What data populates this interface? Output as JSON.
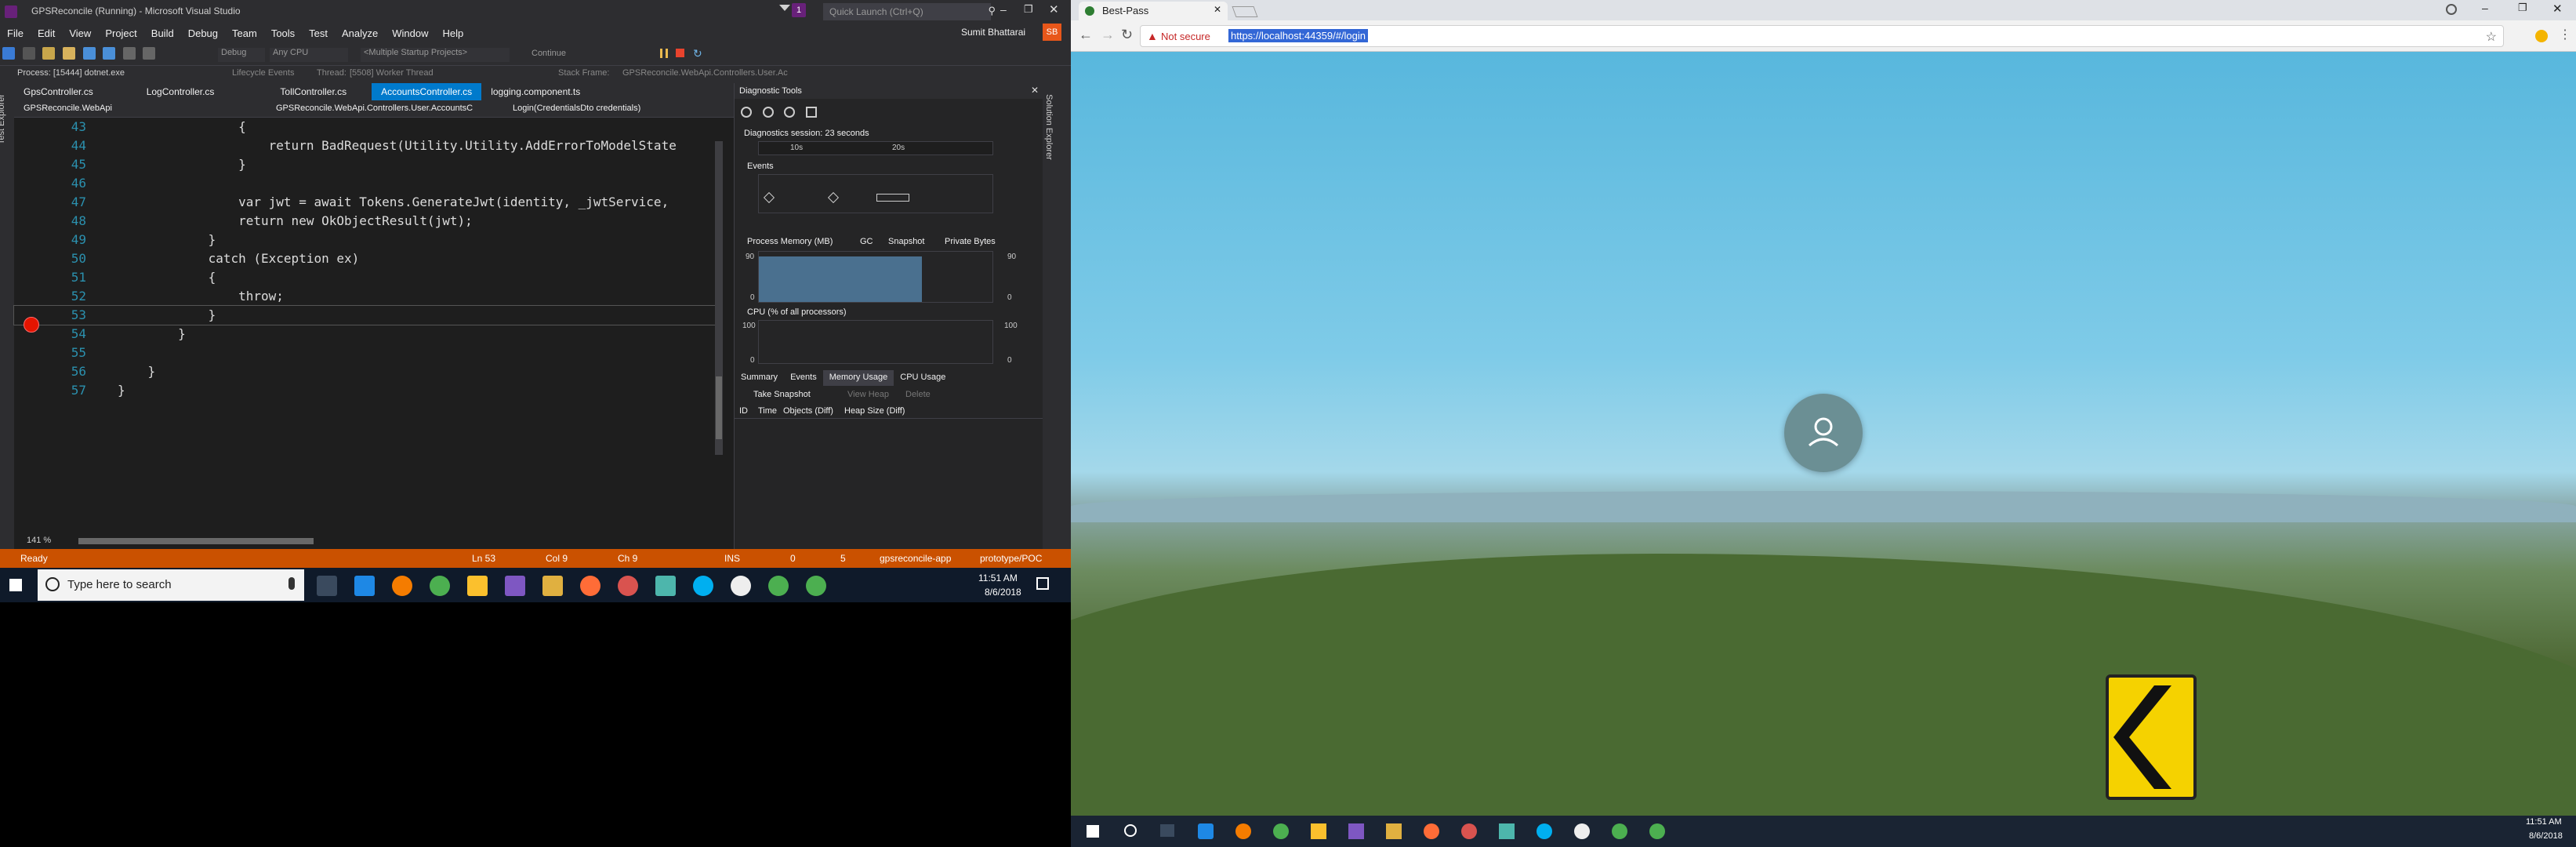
{
  "vs": {
    "title": "GPSReconcile (Running) - Microsoft Visual Studio",
    "quick_launch": "Quick Launch (Ctrl+Q)",
    "user": "Sumit Bhattarai",
    "user_initials": "SB",
    "notifications": "1",
    "menu": [
      "File",
      "Edit",
      "View",
      "Project",
      "Build",
      "Debug",
      "Team",
      "Tools",
      "Test",
      "Analyze",
      "Window",
      "Help"
    ],
    "toolbar": {
      "config": "Debug",
      "platform": "Any CPU",
      "startup": "<Multiple Startup Projects>",
      "continue": "Continue"
    },
    "process_bar": {
      "process": "Process: [15444] dotnet.exe",
      "lifecycle": "Lifecycle Events",
      "thread_label": "Thread:",
      "thread": "[5508] Worker Thread",
      "stack_label": "Stack Frame:",
      "stack": "GPSReconcile.WebApi.Controllers.User.Ac"
    },
    "tabs": [
      {
        "label": "GpsController.cs"
      },
      {
        "label": "LogController.cs"
      },
      {
        "label": "TollController.cs"
      },
      {
        "label": "AccountsController.cs"
      },
      {
        "label": "logging.component.ts"
      }
    ],
    "nav": {
      "project": "GPSReconcile.WebApi",
      "class": "GPSReconcile.WebApi.Controllers.User.AccountsC",
      "member": "Login(CredentialsDto credentials)"
    },
    "code_lines": [
      {
        "n": "43",
        "text": "                {"
      },
      {
        "n": "44",
        "text": "                    return BadRequest(Utility.Utility.AddErrorToModelState"
      },
      {
        "n": "45",
        "text": "                }"
      },
      {
        "n": "46",
        "text": ""
      },
      {
        "n": "47",
        "text": "                var jwt = await Tokens.GenerateJwt(identity, _jwtService,"
      },
      {
        "n": "48",
        "text": "                return new OkObjectResult(jwt);"
      },
      {
        "n": "49",
        "text": "            }"
      },
      {
        "n": "50",
        "text": "            catch (Exception ex)"
      },
      {
        "n": "51",
        "text": "            {"
      },
      {
        "n": "52",
        "text": "                throw;"
      },
      {
        "n": "53",
        "text": "            }"
      },
      {
        "n": "54",
        "text": "        }"
      },
      {
        "n": "55",
        "text": ""
      },
      {
        "n": "56",
        "text": "    }"
      },
      {
        "n": "57",
        "text": "}"
      }
    ],
    "zoom": "141 %",
    "diag": {
      "title": "Diagnostic Tools",
      "session": "Diagnostics session: 23 seconds",
      "timeline_ticks": [
        "10s",
        "20s"
      ],
      "events": "Events",
      "memory": "Process Memory (MB)",
      "gc": "GC",
      "snapshot": "Snapshot",
      "private_bytes": "Private Bytes",
      "mem_max": "90",
      "mem_min": "0",
      "cpu": "CPU (% of all processors)",
      "cpu_max": "100",
      "cpu_min": "0",
      "tabs": [
        "Summary",
        "Events",
        "Memory Usage",
        "CPU Usage"
      ],
      "take_snapshot": "Take Snapshot",
      "view_heap": "View Heap",
      "delete": "Delete",
      "cols": [
        "ID",
        "Time",
        "Objects (Diff)",
        "Heap Size (Diff)"
      ]
    },
    "side_labels": {
      "left": "Test Explorer",
      "right": "Solution Explorer"
    },
    "status": {
      "ready": "Ready",
      "ln": "Ln 53",
      "col": "Col 9",
      "ch": "Ch 9",
      "ins": "INS",
      "arrows": "0",
      "pencil": "5",
      "repo": "gpsreconcile-app",
      "branch": "prototype/POC"
    }
  },
  "taskbar_left": {
    "search": "Type here to search",
    "time": "11:51 AM",
    "date": "8/6/2018"
  },
  "chrome": {
    "tab_title": "Best-Pass",
    "not_secure": "Not secure",
    "url": "https://localhost:44359/#/login"
  },
  "taskbar_right": {
    "time": "11:51 AM",
    "date": "8/6/2018"
  },
  "colors": {
    "vs_accent": "#007acc",
    "vs_status": "#ca5100",
    "breakpoint": "#e51400",
    "sky": "#58b7dd",
    "sign_yellow": "#f5d200"
  }
}
